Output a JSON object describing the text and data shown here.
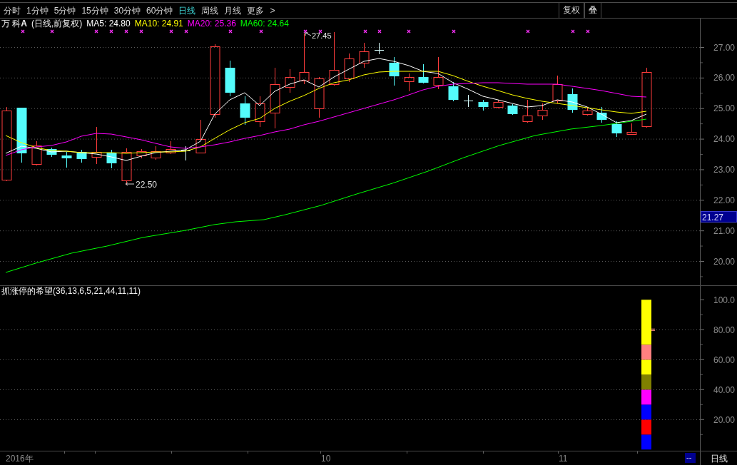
{
  "toolbar": {
    "tabs": [
      {
        "label": "分时",
        "selected": false
      },
      {
        "label": "1分钟",
        "selected": false
      },
      {
        "label": "5分钟",
        "selected": false
      },
      {
        "label": "15分钟",
        "selected": false
      },
      {
        "label": "30分钟",
        "selected": false
      },
      {
        "label": "60分钟",
        "selected": false
      },
      {
        "label": "日线",
        "selected": true
      },
      {
        "label": "周线",
        "selected": false
      },
      {
        "label": "月线",
        "selected": false
      },
      {
        "label": "更多",
        "selected": false
      }
    ],
    "next_symbol": ">",
    "buttons": [
      {
        "label": "复权"
      },
      {
        "label": "叠"
      }
    ]
  },
  "price_panel": {
    "stock_name": "万 科**A**",
    "mode": "(日线,前复权)",
    "moving_averages": [
      {
        "label": "MA5: 24.80",
        "color": "#ffffff"
      },
      {
        "label": "MA10: 24.91",
        "color": "#ffff00"
      },
      {
        "label": "MA20: 25.36",
        "color": "#ff00ff"
      },
      {
        "label": "MA60: 24.64",
        "color": "#00ff00"
      }
    ],
    "annotations": [
      "27.45",
      "22.50"
    ],
    "y_axis_labels": [
      "27.00",
      "26.00",
      "25.00",
      "24.00",
      "23.00",
      "22.00",
      "21.00",
      "20.00"
    ],
    "last_price": "21.27"
  },
  "indicator_panel": {
    "chart_data": {
      "type": "bar",
      "stacked": true,
      "grid": true,
      "title": "抓涨停的希望(36,13,6,5,21,44,11,11)",
      "ylim": [
        0,
        100
      ],
      "yticks": [
        {
          "value": 100,
          "label": "100.0"
        },
        {
          "value": 80,
          "label": "80.00"
        },
        {
          "value": 60,
          "label": "60.00"
        },
        {
          "value": 40,
          "label": "40.00"
        },
        {
          "value": 20,
          "label": "20.00"
        }
      ],
      "series": [
        {
          "color": "#0000ff",
          "values": [
            10
          ]
        },
        {
          "color": "#ff0000",
          "values": [
            10
          ]
        },
        {
          "color": "#0000ff",
          "values": [
            10
          ]
        },
        {
          "color": "#ff00ff",
          "values": [
            10
          ]
        },
        {
          "color": "#808000",
          "values": [
            10
          ]
        },
        {
          "color": "#ffff00",
          "values": [
            10
          ]
        },
        {
          "color": "#ff8080",
          "values": [
            10
          ]
        },
        {
          "color": "#ffff00",
          "values": [
            30
          ]
        }
      ]
    }
  },
  "time_axis": {
    "labels": [
      "2016年",
      "10",
      "11"
    ],
    "status": "--",
    "period": "日线"
  }
}
